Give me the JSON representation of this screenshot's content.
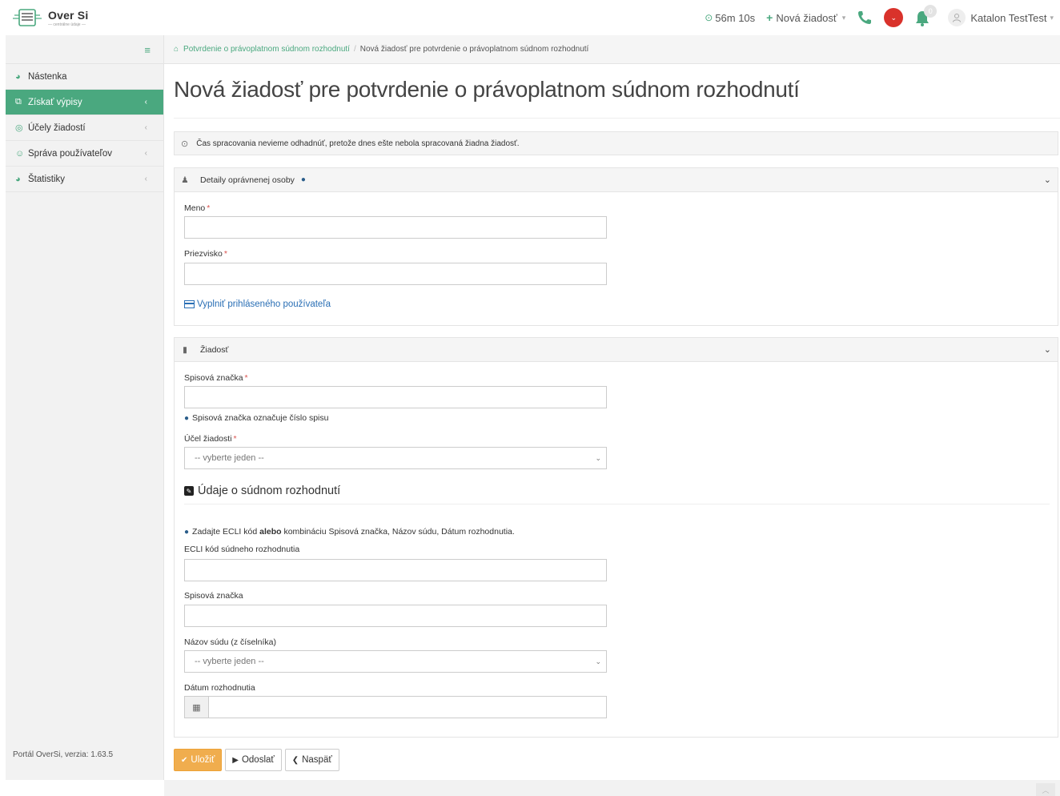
{
  "app": {
    "logo_title": "Over Si",
    "logo_sub": "— centrálne údaje —"
  },
  "topbar": {
    "timer": "56m 10s",
    "new_request": "Nová žiadosť",
    "notification_count": "0",
    "user_name": "Katalon TestTest"
  },
  "sidebar": {
    "items": [
      {
        "label": "Nástenka",
        "icon": "dashboard-icon"
      },
      {
        "label": "Získať výpisy",
        "icon": "documents-icon",
        "active": true
      },
      {
        "label": "Účely žiadostí",
        "icon": "target-icon"
      },
      {
        "label": "Správa používateľov",
        "icon": "users-icon"
      },
      {
        "label": "Štatistiky",
        "icon": "stats-icon"
      }
    ],
    "footer": "Portál OverSi, verzia: 1.63.5"
  },
  "breadcrumb": {
    "link": "Potvrdenie o právoplatnom súdnom rozhodnutí",
    "current": "Nová žiadosť pre potvrdenie o právoplatnom súdnom rozhodnutí"
  },
  "page": {
    "title": "Nová žiadosť pre potvrdenie o právoplatnom súdnom rozhodnutí",
    "info_message": "Čas spracovania nevieme odhadnúť, pretože dnes ešte nebola spracovaná žiadna žiadosť."
  },
  "person_panel": {
    "title": "Detaily oprávnenej osoby",
    "first_name_label": "Meno",
    "first_name_value": "",
    "last_name_label": "Priezvisko",
    "last_name_value": "",
    "fill_link": "Vyplniť prihláseného používateľa"
  },
  "request_panel": {
    "title": "Žiadosť",
    "file_number_label": "Spisová značka",
    "file_number_value": "",
    "file_number_help": "Spisová značka označuje číslo spisu",
    "purpose_label": "Účel žiadosti",
    "purpose_selected": "-- vyberte jeden --",
    "decision_heading": "Údaje o súdnom rozhodnutí",
    "decision_help_pre": "Zadajte ECLI kód",
    "decision_help_bold": "alebo",
    "decision_help_post": "kombináciu Spisová značka, Názov súdu, Dátum rozhodnutia.",
    "ecli_label": "ECLI kód súdneho rozhodnutia",
    "ecli_value": "",
    "decision_file_label": "Spisová značka",
    "decision_file_value": "",
    "court_label": "Názov súdu (z číselníka)",
    "court_selected": "-- vyberte jeden --",
    "date_label": "Dátum rozhodnutia",
    "date_value": ""
  },
  "actions": {
    "save": "Uložiť",
    "submit": "Odoslať",
    "back": "Naspäť"
  },
  "colors": {
    "accent": "#4aa87f",
    "save_button": "#f0ad4e",
    "record_button": "#d9322b",
    "link": "#2a6fb5"
  }
}
